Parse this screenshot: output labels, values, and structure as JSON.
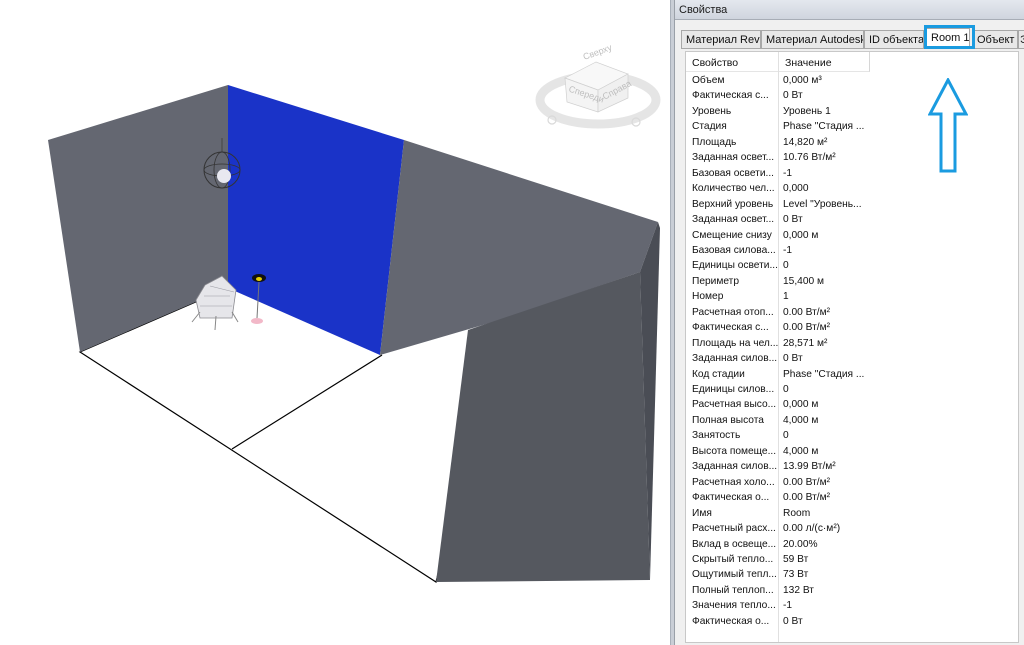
{
  "panel": {
    "title": "Свойства",
    "tabs": [
      {
        "label": "Материал Revit",
        "active": false
      },
      {
        "label": "Материал Autodesk",
        "active": false
      },
      {
        "label": "ID объекта",
        "active": false
      },
      {
        "label": "Room 1",
        "active": true
      },
      {
        "label": "Объект",
        "active": false
      },
      {
        "label": "Э",
        "active": false
      }
    ],
    "header": {
      "property": "Свойство",
      "value": "Значение"
    },
    "rows": [
      {
        "k": "Объем",
        "v": "0,000 м³"
      },
      {
        "k": "Фактическая с...",
        "v": "0 Вт"
      },
      {
        "k": "Уровень",
        "v": "Уровень 1"
      },
      {
        "k": "Стадия",
        "v": "Phase \"Стадия ..."
      },
      {
        "k": "Площадь",
        "v": "14,820 м²"
      },
      {
        "k": "Заданная освет...",
        "v": "10.76 Вт/м²"
      },
      {
        "k": "Базовая освети...",
        "v": "-1"
      },
      {
        "k": "Количество чел...",
        "v": "0,000"
      },
      {
        "k": "Верхний уровень",
        "v": "Level \"Уровень..."
      },
      {
        "k": "Заданная освет...",
        "v": "0 Вт"
      },
      {
        "k": "Смещение снизу",
        "v": "0,000 м"
      },
      {
        "k": "Базовая силова...",
        "v": "-1"
      },
      {
        "k": "Единицы освети...",
        "v": "0"
      },
      {
        "k": "Периметр",
        "v": "15,400 м"
      },
      {
        "k": "Номер",
        "v": "1"
      },
      {
        "k": "Расчетная отоп...",
        "v": "0.00 Вт/м²"
      },
      {
        "k": "Фактическая с...",
        "v": "0.00 Вт/м²"
      },
      {
        "k": "Площадь на чел...",
        "v": "28,571 м²"
      },
      {
        "k": "Заданная силов...",
        "v": "0 Вт"
      },
      {
        "k": "Код стадии",
        "v": "Phase \"Стадия ..."
      },
      {
        "k": "Единицы силов...",
        "v": "0"
      },
      {
        "k": "Расчетная высо...",
        "v": "0,000 м"
      },
      {
        "k": "Полная высота",
        "v": "4,000 м"
      },
      {
        "k": "Занятость",
        "v": "0"
      },
      {
        "k": "Высота помеще...",
        "v": "4,000 м"
      },
      {
        "k": "Заданная силов...",
        "v": "13.99 Вт/м²"
      },
      {
        "k": "Расчетная холо...",
        "v": "0.00 Вт/м²"
      },
      {
        "k": "Фактическая о...",
        "v": "0.00 Вт/м²"
      },
      {
        "k": "Имя",
        "v": "Room"
      },
      {
        "k": "Расчетный расх...",
        "v": "0.00 л/(с·м²)"
      },
      {
        "k": "Вклад в освеще...",
        "v": "20.00%"
      },
      {
        "k": "Скрытый тепло...",
        "v": "59 Вт"
      },
      {
        "k": "Ощутимый тепл...",
        "v": "73 Вт"
      },
      {
        "k": "Полный теплоп...",
        "v": "132 Вт"
      },
      {
        "k": "Значения тепло...",
        "v": "-1"
      },
      {
        "k": "Фактическая о...",
        "v": "0 Вт"
      }
    ]
  },
  "viewcube": {
    "top": "Сверху",
    "front": "Спереди",
    "right": "Справа"
  },
  "colors": {
    "wall_gray": "#646771",
    "wall_dark": "#55585f",
    "wall_blue": "#1a33c8",
    "highlight": "#1a9be0"
  }
}
